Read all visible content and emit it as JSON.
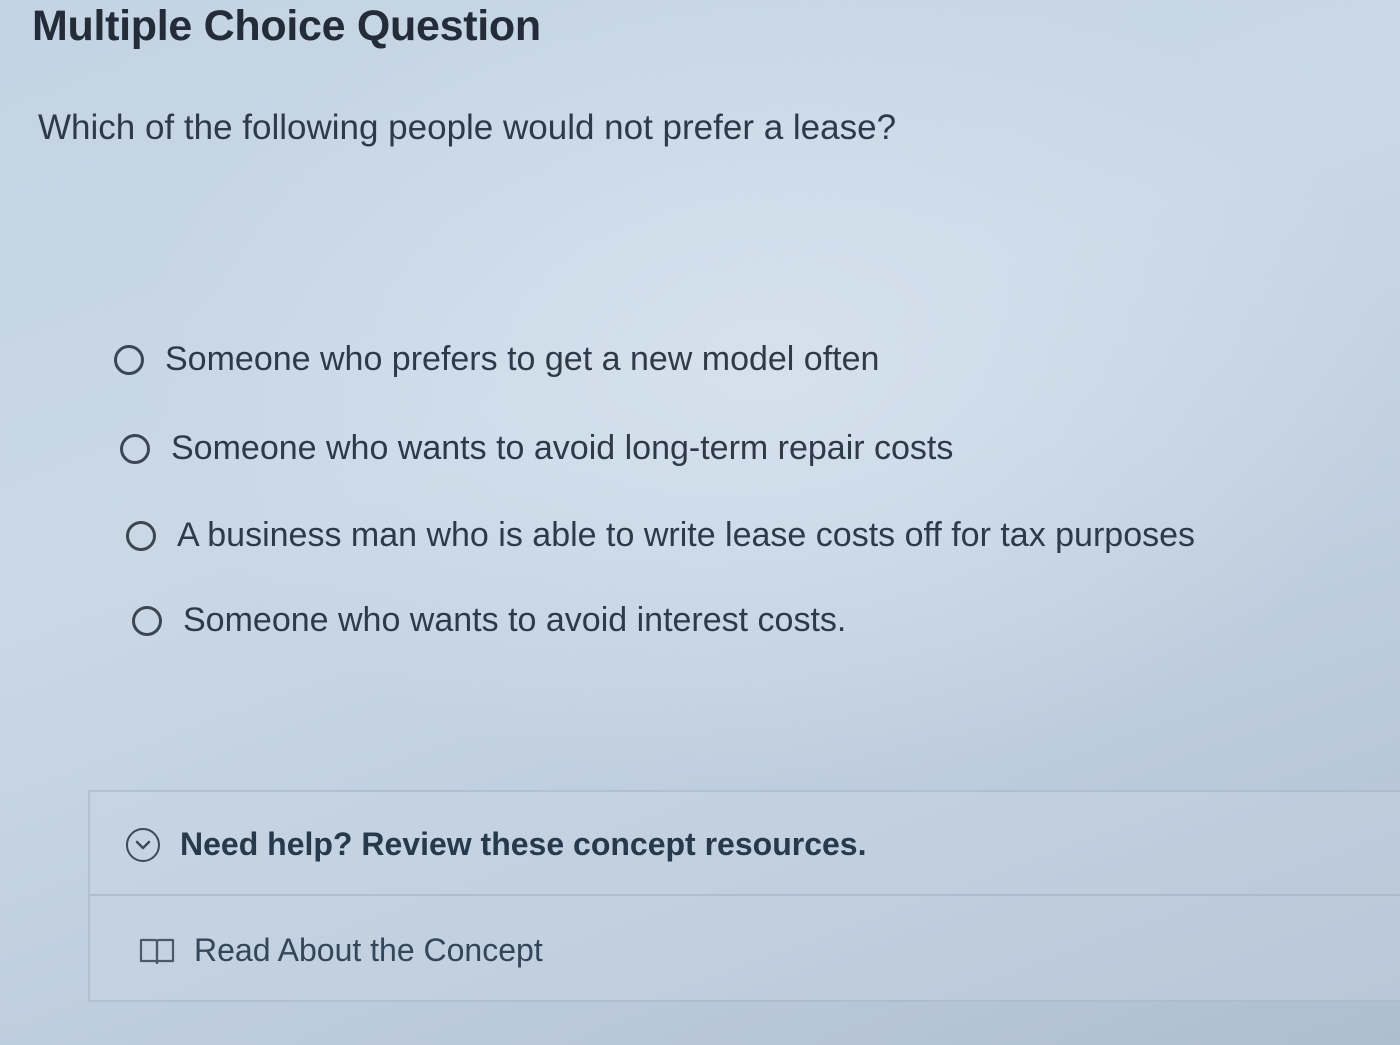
{
  "header": {
    "title": "Multiple Choice Question"
  },
  "question": {
    "text": "Which of the following people would not prefer a lease?"
  },
  "choices": [
    {
      "label": "Someone who prefers to get a new model often"
    },
    {
      "label": "Someone who wants to avoid long-term repair costs"
    },
    {
      "label": "A business man who is able to write lease costs off for tax purposes"
    },
    {
      "label": "Someone who wants to avoid interest costs."
    }
  ],
  "help": {
    "title": "Need help? Review these concept resources.",
    "icon": "chevron-down-icon",
    "resources": [
      {
        "label": "Read About the Concept",
        "icon": "book-icon"
      }
    ]
  },
  "colors": {
    "text": "#2f3a48",
    "title": "#232c38",
    "help_text": "#27394c"
  }
}
